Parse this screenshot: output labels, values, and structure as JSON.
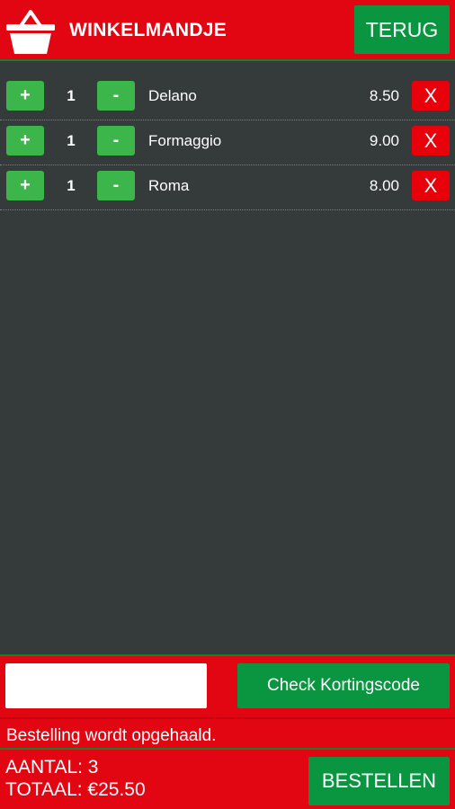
{
  "header": {
    "title": "WINKELMANDJE",
    "back_label": "TERUG",
    "icon": "basket-icon"
  },
  "cart": {
    "plus_label": "+",
    "minus_label": "-",
    "remove_label": "X",
    "items": [
      {
        "qty": "1",
        "name": "Delano",
        "price": "8.50"
      },
      {
        "qty": "1",
        "name": "Formaggio",
        "price": "9.00"
      },
      {
        "qty": "1",
        "name": "Roma",
        "price": "8.00"
      }
    ]
  },
  "discount": {
    "input_value": "",
    "check_label": "Check Kortingscode"
  },
  "status": {
    "text": "Bestelling wordt opgehaald."
  },
  "footer": {
    "count_text": "AANTAL: 3",
    "total_text": "TOTAAL: €25.50",
    "order_label": "BESTELLEN"
  },
  "colors": {
    "brand_red": "#e20613",
    "action_green": "#0a9640",
    "qty_green": "#3cb54a",
    "remove_red": "#e8000b",
    "background": "#353a3a"
  }
}
